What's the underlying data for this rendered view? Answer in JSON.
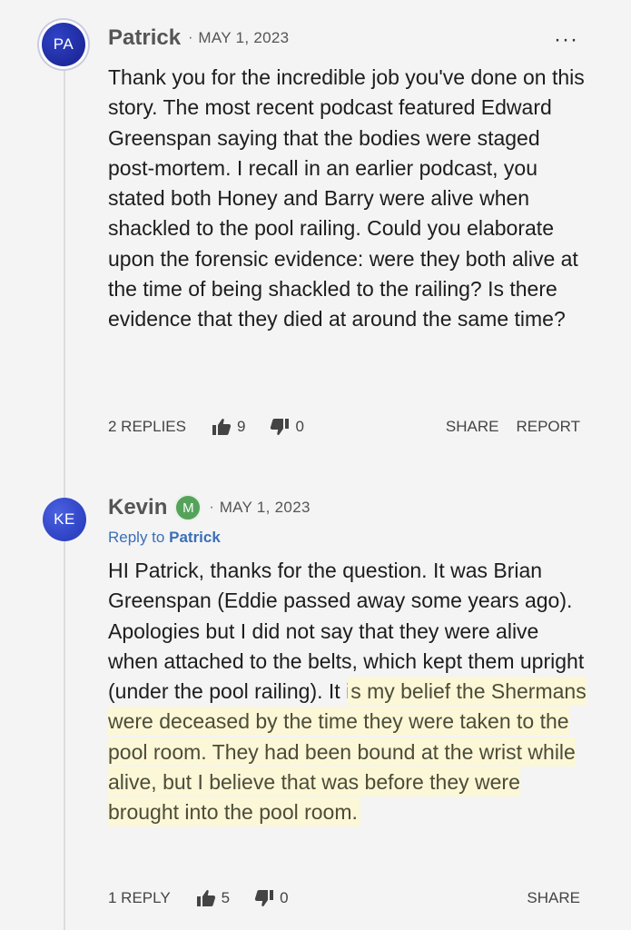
{
  "comments": [
    {
      "avatar": "PA",
      "author": "Patrick",
      "separator": "·",
      "date": "MAY 1, 2023",
      "more": "···",
      "body": "Thank you for the incredible job you've done on this story. The most recent podcast featured Edward Greenspan saying that the bodies were staged post-mortem. I recall in an earlier podcast, you stated both Honey and Barry were alive when shackled to the pool railing. Could you elaborate upon the forensic evidence: were they both alive at the time of being shackled to the railing? Is there evidence that they died at around the same time?",
      "replies": "2 REPLIES",
      "likes": "9",
      "dislikes": "0",
      "share": "SHARE",
      "report": "REPORT"
    },
    {
      "avatar": "KE",
      "author": "Kevin",
      "badge": "M",
      "separator": "·",
      "date": "MAY 1, 2023",
      "reply_prefix": "Reply to",
      "reply_target": "Patrick",
      "body_plain": "HI Patrick, thanks for the question. It was Brian Greenspan (Eddie passed away some years ago). Apologies but I did not say that they were alive when attached to the belts, which kept them upright (under the pool railing). It i",
      "body_highlight": "s my belief the Shermans were deceased by the time they were taken to the pool room. They had been bound at the wrist while alive, but I believe that was before they were brought into the pool room.",
      "replies": "1 REPLY",
      "likes": "5",
      "dislikes": "0",
      "share": "SHARE"
    }
  ],
  "icons": {
    "like": "thumbs-up-icon",
    "dislike": "thumbs-down-icon",
    "more": "more-options-icon"
  },
  "colors": {
    "background": "#f4f4f5",
    "avatar_blue": "#2638b8",
    "moderator_green": "#55a35a",
    "reply_link": "#3b6fb5",
    "highlight": "#fbf7d7"
  }
}
